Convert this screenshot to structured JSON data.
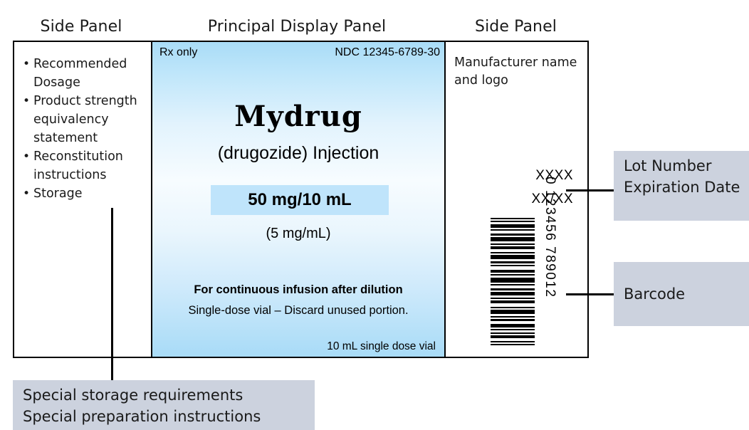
{
  "titles": {
    "side_panel_left": "Side Panel",
    "principal_display_panel": "Principal Display Panel",
    "side_panel_right": "Side Panel"
  },
  "side_panel_left": {
    "bullets": [
      "Recommended Dosage",
      "Product strength equivalency statement",
      "Reconstitution instructions",
      "Storage"
    ]
  },
  "principal_display_panel": {
    "rx_only": "Rx only",
    "ndc": "NDC 12345-6789-30",
    "brand_name": "Mydrug",
    "generic_name": "(drugozide) Injection",
    "strength": "50 mg/10 mL",
    "concentration": "(5 mg/mL)",
    "infusion_statement": "For continuous infusion after dilution",
    "single_dose_statement": "Single-dose vial – Discard unused portion.",
    "vial_size": "10 mL single dose vial"
  },
  "side_panel_right": {
    "manufacturer": "Manufacturer name and logo",
    "lot_number_value": "XXXX",
    "expiration_date_value": "XX/XX",
    "barcode_digits": "0 123456 789012"
  },
  "callouts": {
    "lot_number": "Lot Number",
    "expiration_date": "Expiration Date",
    "barcode": "Barcode",
    "special_storage": "Special storage requirements",
    "special_preparation": "Special preparation instructions"
  },
  "colors": {
    "pdp_gradient_top": "#a9dcf7",
    "pdp_gradient_mid": "#f7fcff",
    "strength_box": "#bfe4fb",
    "callout_box": "#ccd2de",
    "frame_border": "#000000"
  }
}
